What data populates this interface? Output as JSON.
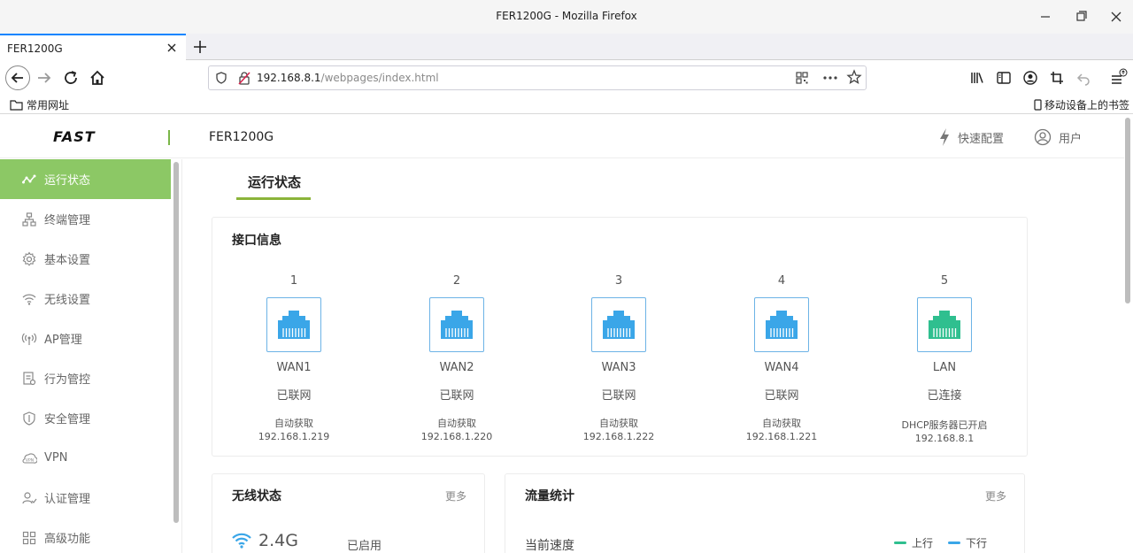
{
  "browser": {
    "window_title": "FER1200G - Mozilla Firefox",
    "tab_title": "FER1200G",
    "url_host": "192.168.8.1",
    "url_path": "/webpages/index.html",
    "bookmark_left": "常用网址",
    "bookmark_right": "移动设备上的书签"
  },
  "header": {
    "brand": "FAST",
    "model": "FER1200G",
    "quick_config": "快速配置",
    "user": "用户"
  },
  "sidebar": {
    "items": [
      {
        "label": "运行状态",
        "icon": "status-icon",
        "active": true
      },
      {
        "label": "终端管理",
        "icon": "network-tree-icon"
      },
      {
        "label": "基本设置",
        "icon": "gear-icon"
      },
      {
        "label": "无线设置",
        "icon": "wifi-icon"
      },
      {
        "label": "AP管理",
        "icon": "ap-icon"
      },
      {
        "label": "行为管控",
        "icon": "control-icon"
      },
      {
        "label": "安全管理",
        "icon": "shield-icon"
      },
      {
        "label": "VPN",
        "icon": "vpn-icon"
      },
      {
        "label": "认证管理",
        "icon": "user-auth-icon"
      },
      {
        "label": "高级功能",
        "icon": "grid-icon"
      }
    ]
  },
  "page": {
    "tab": "运行状态"
  },
  "interfaces": {
    "title": "接口信息",
    "ports": [
      {
        "num": "1",
        "name": "WAN1",
        "status": "已联网",
        "mode": "自动获取",
        "ip": "192.168.1.219",
        "color": "#3aa6e8"
      },
      {
        "num": "2",
        "name": "WAN2",
        "status": "已联网",
        "mode": "自动获取",
        "ip": "192.168.1.220",
        "color": "#3aa6e8"
      },
      {
        "num": "3",
        "name": "WAN3",
        "status": "已联网",
        "mode": "自动获取",
        "ip": "192.168.1.222",
        "color": "#3aa6e8"
      },
      {
        "num": "4",
        "name": "WAN4",
        "status": "已联网",
        "mode": "自动获取",
        "ip": "192.168.1.221",
        "color": "#3aa6e8"
      },
      {
        "num": "5",
        "name": "LAN",
        "status": "已连接",
        "mode": "DHCP服务器已开启",
        "ip": "192.168.8.1",
        "color": "#2fbf8f"
      }
    ]
  },
  "wireless": {
    "title": "无线状态",
    "more": "更多",
    "band": "2.4G",
    "band_status": "已启用"
  },
  "traffic": {
    "title": "流量统计",
    "more": "更多",
    "current_speed": "当前速度",
    "legend_up": "上行",
    "legend_down": "下行",
    "color_up": "#2fbf8f",
    "color_down": "#3aa6e8"
  }
}
